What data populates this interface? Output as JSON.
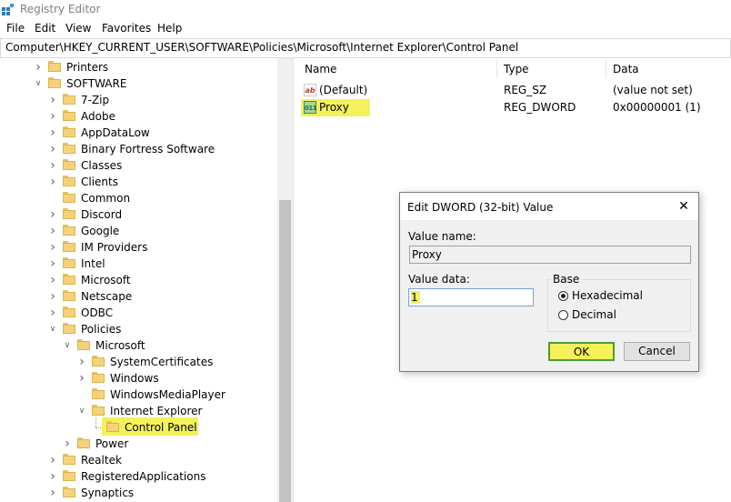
{
  "window": {
    "title": "Registry Editor"
  },
  "menu": [
    "File",
    "Edit",
    "View",
    "Favorites",
    "Help"
  ],
  "address": "Computer\\HKEY_CURRENT_USER\\SOFTWARE\\Policies\\Microsoft\\Internet Explorer\\Control Panel",
  "tree": {
    "items": [
      {
        "label": "Printers",
        "expanded": false,
        "highlighted": false
      },
      {
        "label": "SOFTWARE",
        "expanded": true,
        "highlighted": false
      },
      {
        "label": "7-Zip",
        "expanded": false,
        "highlighted": false
      },
      {
        "label": "Adobe",
        "expanded": false,
        "highlighted": false
      },
      {
        "label": "AppDataLow",
        "expanded": false,
        "highlighted": false
      },
      {
        "label": "Binary Fortress Software",
        "expanded": false,
        "highlighted": false
      },
      {
        "label": "Classes",
        "expanded": false,
        "highlighted": false
      },
      {
        "label": "Clients",
        "expanded": false,
        "highlighted": false
      },
      {
        "label": "Common",
        "expanded": false,
        "highlighted": false
      },
      {
        "label": "Discord",
        "expanded": false,
        "highlighted": false
      },
      {
        "label": "Google",
        "expanded": false,
        "highlighted": false
      },
      {
        "label": "IM Providers",
        "expanded": false,
        "highlighted": false
      },
      {
        "label": "Intel",
        "expanded": false,
        "highlighted": false
      },
      {
        "label": "Microsoft",
        "expanded": false,
        "highlighted": false
      },
      {
        "label": "Netscape",
        "expanded": false,
        "highlighted": false
      },
      {
        "label": "ODBC",
        "expanded": false,
        "highlighted": false
      },
      {
        "label": "Policies",
        "expanded": true,
        "highlighted": false
      },
      {
        "label": "Microsoft",
        "expanded": true,
        "highlighted": false
      },
      {
        "label": "SystemCertificates",
        "expanded": false,
        "highlighted": false
      },
      {
        "label": "Windows",
        "expanded": false,
        "highlighted": false
      },
      {
        "label": "WindowsMediaPlayer",
        "expanded": false,
        "highlighted": false
      },
      {
        "label": "Internet Explorer",
        "expanded": true,
        "highlighted": false
      },
      {
        "label": "Control Panel",
        "expanded": false,
        "highlighted": true
      },
      {
        "label": "Power",
        "expanded": false,
        "highlighted": false
      },
      {
        "label": "Realtek",
        "expanded": false,
        "highlighted": false
      },
      {
        "label": "RegisteredApplications",
        "expanded": false,
        "highlighted": false
      },
      {
        "label": "Synaptics",
        "expanded": false,
        "highlighted": false
      }
    ]
  },
  "list": {
    "columns": [
      "Name",
      "Type",
      "Data"
    ],
    "rows": [
      {
        "name": "(Default)",
        "type": "REG_SZ",
        "data": "(value not set)",
        "icon": "string-value-icon",
        "icon_text": "ab",
        "highlighted": false
      },
      {
        "name": "Proxy",
        "type": "REG_DWORD",
        "data": "0x00000001 (1)",
        "icon": "dword-value-icon",
        "icon_text": "011",
        "highlighted": true
      }
    ]
  },
  "dialog": {
    "title": "Edit DWORD (32-bit) Value",
    "value_name_label": "Value name:",
    "value_name": "Proxy",
    "value_data_label": "Value data:",
    "value_data": "1",
    "base_label": "Base",
    "base_options": [
      {
        "label": "Hexadecimal",
        "selected": true
      },
      {
        "label": "Decimal",
        "selected": false
      }
    ],
    "ok": "OK",
    "cancel": "Cancel"
  },
  "colors": {
    "highlight": "#f4f15a",
    "ok_border": "#4a9a3c",
    "folder": "#f5d27a"
  }
}
